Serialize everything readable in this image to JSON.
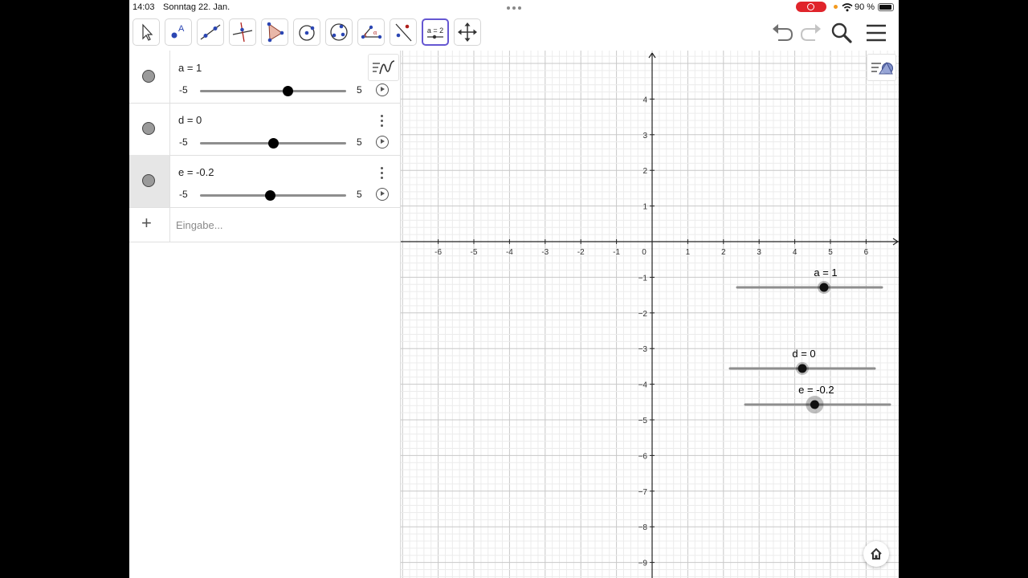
{
  "status_bar": {
    "time": "14:03",
    "date": "Sonntag 22. Jan.",
    "battery": "90 %"
  },
  "toolbar": {
    "tools": [
      "move",
      "point",
      "line",
      "perpendicular-line",
      "polygon",
      "circle-center-point",
      "circle-three-points",
      "angle",
      "reflect",
      "slider",
      "move-graphics-view"
    ],
    "active_tool": "slider",
    "slider_tool_label": "a = 2"
  },
  "algebra": {
    "items": [
      {
        "definition": "a = 1",
        "min": "-5",
        "max": "5",
        "value": 1,
        "range": [
          -5,
          5
        ]
      },
      {
        "definition": "d = 0",
        "min": "-5",
        "max": "5",
        "value": 0,
        "range": [
          -5,
          5
        ]
      },
      {
        "definition": "e = -0.2",
        "min": "-5",
        "max": "5",
        "value": -0.2,
        "range": [
          -5,
          5
        ]
      }
    ],
    "selected_index": 2,
    "input_placeholder": "Eingabe..."
  },
  "graphics": {
    "x_ticks": [
      "-6",
      "-5",
      "-4",
      "-3",
      "-2",
      "-1",
      "0",
      "1",
      "2",
      "3",
      "4",
      "5",
      "6"
    ],
    "y_ticks": [
      "4",
      "3",
      "2",
      "1",
      "−1",
      "−2",
      "−3",
      "−4",
      "−5",
      "−6",
      "−7",
      "−8",
      "−9"
    ],
    "sliders": [
      {
        "label": "a = 1",
        "value": 1,
        "range": [
          -5,
          5
        ]
      },
      {
        "label": "d = 0",
        "value": 0,
        "range": [
          -5,
          5
        ]
      },
      {
        "label": "e = -0.2",
        "value": -0.2,
        "range": [
          -5,
          5
        ],
        "selected": true
      }
    ]
  },
  "colors": {
    "toolbar_active": "#6557d2",
    "grid_major": "#c8c8c8",
    "grid_minor": "#ececec",
    "slider_track": "#8e8e8e",
    "record_indicator": "#e0242b"
  }
}
